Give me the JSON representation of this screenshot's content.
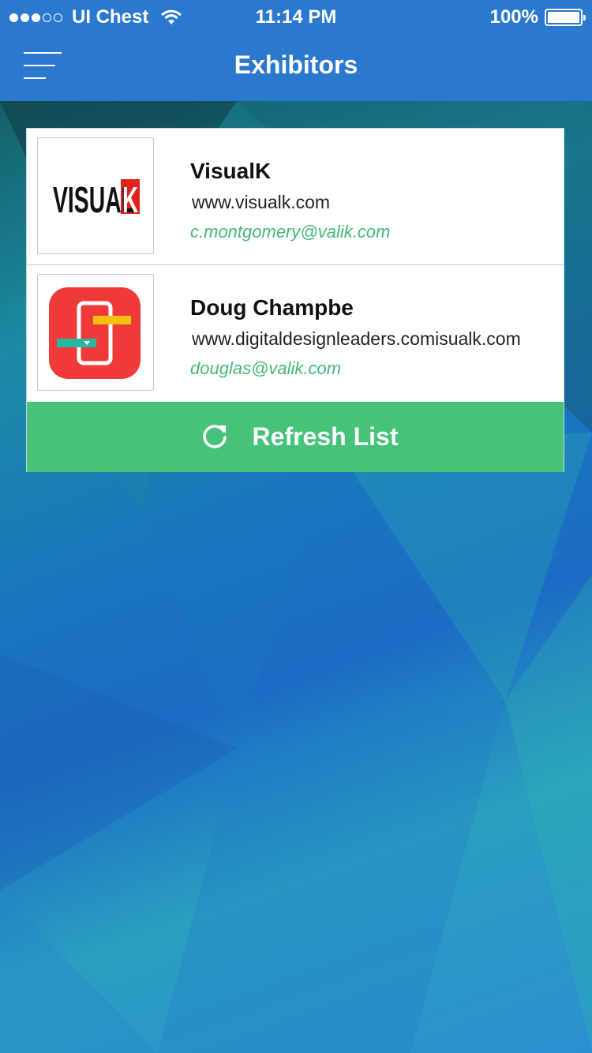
{
  "status_bar": {
    "carrier": "UI Chest",
    "time": "11:14 PM",
    "battery": "100%",
    "signal_bars_filled": 3,
    "signal_bars_total": 5,
    "battery_level": 1.0
  },
  "header": {
    "title": "Exhibitors",
    "menu_icon": "hamburger-menu-icon"
  },
  "exhibitors": [
    {
      "name": "VisualK",
      "url": "www.visualk.com",
      "email": "c.montgomery@valik.com",
      "logo_text": "VISUALK"
    },
    {
      "name": "Doug Champbe",
      "url": "www.digitaldesignleaders.comisualk.com",
      "email": "douglas@valik.com"
    }
  ],
  "refresh": {
    "label": "Refresh List",
    "icon": "refresh-icon"
  },
  "colors": {
    "header": "#2a79cf",
    "accent_green": "#46c27a",
    "email_green": "#45b977",
    "logo_red": "#f03a3a"
  }
}
